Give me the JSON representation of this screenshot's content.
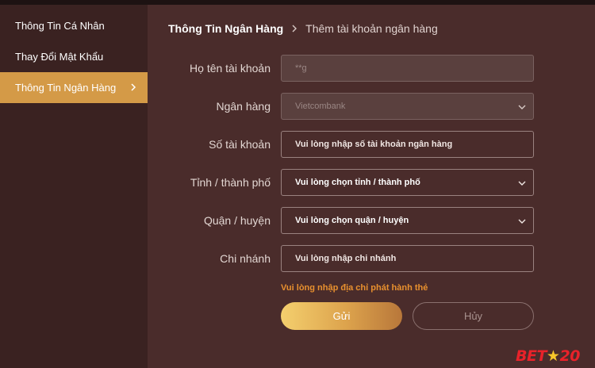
{
  "sidebar": {
    "items": [
      {
        "label": "Thông Tin Cá Nhân",
        "active": false
      },
      {
        "label": "Thay Đổi Mật Khẩu",
        "active": false
      },
      {
        "label": "Thông Tin Ngân Hàng",
        "active": true
      }
    ]
  },
  "breadcrumb": {
    "root": "Thông Tin Ngân Hàng",
    "current": "Thêm tài khoản ngân hàng"
  },
  "form": {
    "account_name": {
      "label": "Họ tên tài khoản",
      "value": "**g"
    },
    "bank": {
      "label": "Ngân hàng",
      "value": "Vietcombank"
    },
    "account_number": {
      "label": "Số tài khoản",
      "placeholder": "Vui lòng nhập số tài khoản ngân hàng"
    },
    "province": {
      "label": "Tỉnh / thành phố",
      "value": "Vui lòng chọn tỉnh / thành phố"
    },
    "district": {
      "label": "Quận / huyện",
      "value": "Vui lòng chọn quận / huyện"
    },
    "branch": {
      "label": "Chi nhánh",
      "placeholder": "Vui lòng nhập chi nhánh"
    },
    "hint": "Vui lòng nhập địa chỉ phát hành thẻ"
  },
  "buttons": {
    "submit": "Gửi",
    "cancel": "Hủy"
  },
  "logo": {
    "text_left": "BET",
    "text_right": "20"
  },
  "colors": {
    "accent": "#d49a47",
    "background": "#4a2c2b",
    "sidebar": "#3a2221",
    "hint": "#e8902e"
  }
}
